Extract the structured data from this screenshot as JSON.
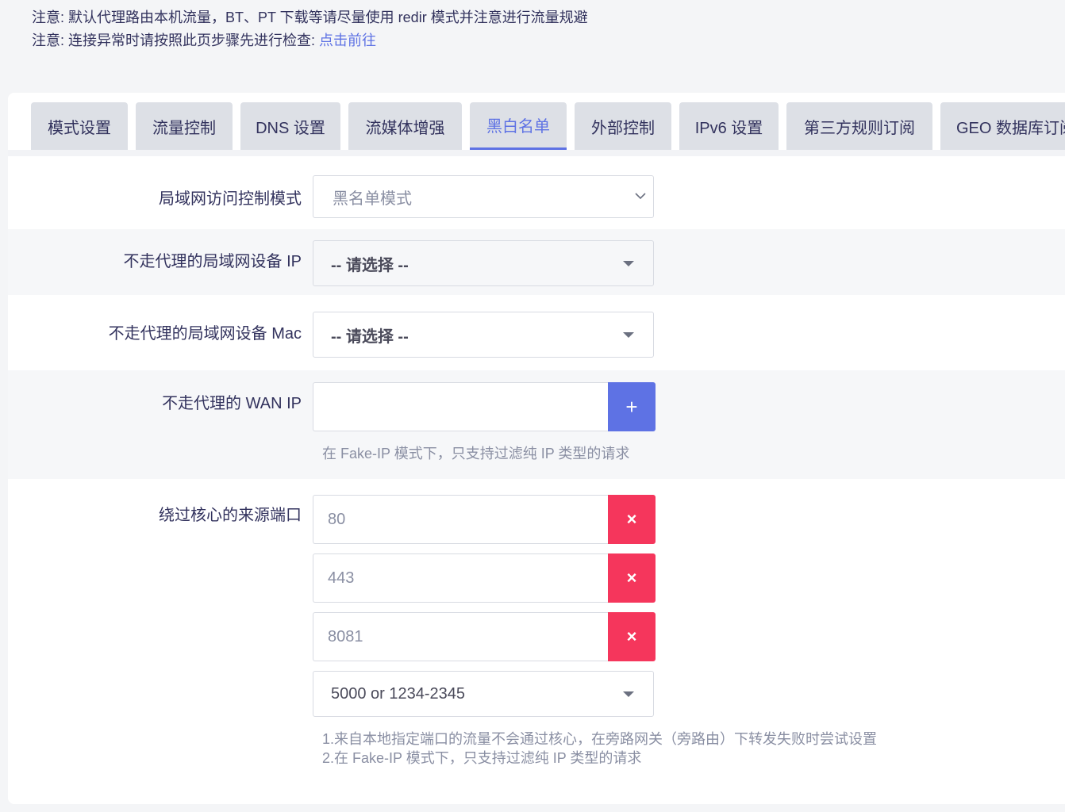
{
  "notices": {
    "line1": "注意: 默认代理路由本机流量，BT、PT 下载等请尽量使用 redir 模式并注意进行流量规避",
    "line2_prefix": "注意: 连接异常时请按照此页步骤先进行检查: ",
    "line2_link": "点击前往"
  },
  "tabs": [
    {
      "label": "模式设置"
    },
    {
      "label": "流量控制"
    },
    {
      "label": "DNS 设置"
    },
    {
      "label": "流媒体增强"
    },
    {
      "label": "黑白名单",
      "active": true
    },
    {
      "label": "外部控制"
    },
    {
      "label": "IPv6 设置"
    },
    {
      "label": "第三方规则订阅"
    },
    {
      "label": "GEO 数据库订阅"
    }
  ],
  "form": {
    "lan_mode": {
      "label": "局域网访问控制模式",
      "value": "黑名单模式"
    },
    "lan_ip": {
      "label": "不走代理的局域网设备 IP",
      "value": "-- 请选择 --"
    },
    "lan_mac": {
      "label": "不走代理的局域网设备 Mac",
      "value": "-- 请选择 --"
    },
    "wan_ip": {
      "label": "不走代理的 WAN IP",
      "value": "",
      "add_button": "+",
      "help": "在 Fake-IP 模式下，只支持过滤纯 IP 类型的请求"
    },
    "bypass_ports": {
      "label": "绕过核心的来源端口",
      "values": [
        "80",
        "443",
        "8081"
      ],
      "remove_button": "×",
      "select_value": "5000 or 1234-2345",
      "help_line1": "1.来自本地指定端口的流量不会通过核心，在旁路网关（旁路由）下转发失败时尝试设置",
      "help_line2": "2.在 Fake-IP 模式下，只支持过滤纯 IP 类型的请求"
    }
  },
  "colors": {
    "accent": "#5e72e4",
    "danger": "#f5365c",
    "tab_bg": "#dde0e6",
    "page_bg": "#f4f5f7"
  }
}
